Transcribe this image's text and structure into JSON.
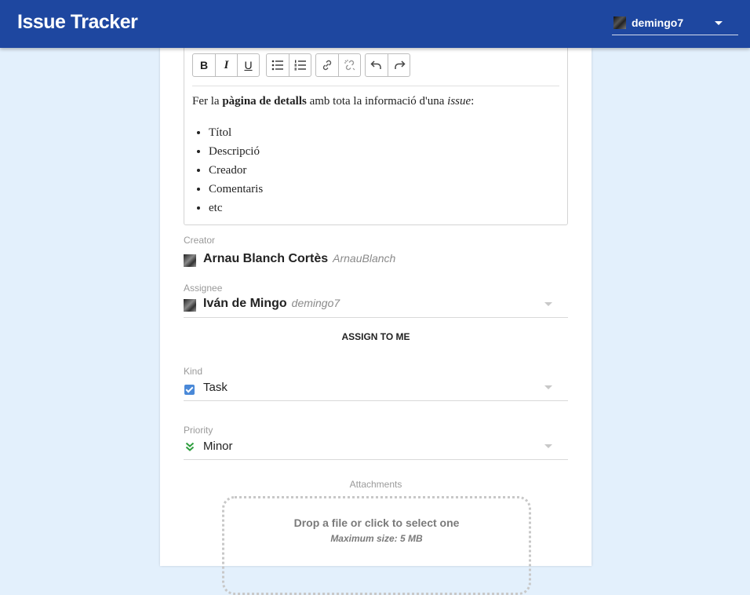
{
  "app": {
    "title": "Issue Tracker",
    "current_user": "demingo7"
  },
  "editor": {
    "toolbar": {
      "bold": "B",
      "italic": "I",
      "underline": "U"
    },
    "content": {
      "intro_before": "Fer la ",
      "intro_bold": "pàgina de detalls",
      "intro_middle": " amb tota la informació d'una ",
      "intro_italic": "issue",
      "intro_after": ":",
      "items": [
        "Títol",
        "Descripció",
        "Creador",
        "Comentaris",
        "etc"
      ]
    }
  },
  "creator": {
    "label": "Creator",
    "name": "Arnau Blanch Cortès",
    "username": "ArnauBlanch"
  },
  "assignee": {
    "label": "Assignee",
    "name": "Iván de Mingo",
    "username": "demingo7"
  },
  "assign_button": "ASSIGN TO ME",
  "kind": {
    "label": "Kind",
    "value": "Task",
    "icon": "task-checkbox-icon"
  },
  "priority": {
    "label": "Priority",
    "value": "Minor",
    "icon": "double-chevron-down-icon",
    "color": "#2e9e3e"
  },
  "attachments": {
    "label": "Attachments",
    "drop_text": "Drop a file or click to select one",
    "max_size": "Maximum size: 5 MB"
  },
  "colors": {
    "header": "#1e47a0",
    "background": "#e3f0fc",
    "kind_icon": "#4a89d8"
  }
}
